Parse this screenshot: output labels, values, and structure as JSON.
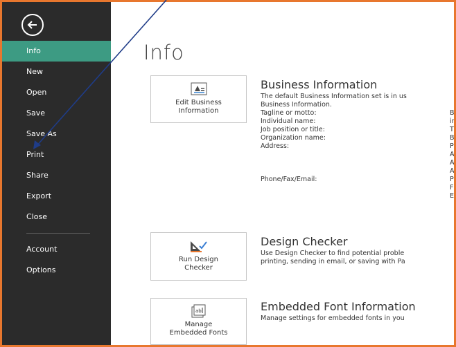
{
  "sidebar": {
    "items": [
      {
        "label": "Info",
        "active": true
      },
      {
        "label": "New"
      },
      {
        "label": "Open"
      },
      {
        "label": "Save"
      },
      {
        "label": "Save As"
      },
      {
        "label": "Print"
      },
      {
        "label": "Share"
      },
      {
        "label": "Export"
      },
      {
        "label": "Close"
      }
    ],
    "lower_items": [
      {
        "label": "Account"
      },
      {
        "label": "Options"
      }
    ]
  },
  "main": {
    "title": "Info",
    "business": {
      "button_line1": "Edit Business",
      "button_line2": "Information",
      "heading": "Business Information",
      "desc_line1": "The default Business Information set is in us",
      "desc_line2": "Business Information.",
      "fields": [
        {
          "label": "Tagline or motto:",
          "value": "B"
        },
        {
          "label": "Individual name:",
          "value": "in"
        },
        {
          "label": "Job position or title:",
          "value": "Ti"
        },
        {
          "label": "Organization name:",
          "value": "B"
        },
        {
          "label": "Address:",
          "value": "P"
        },
        {
          "label": "",
          "value": "A"
        },
        {
          "label": "",
          "value": "A"
        },
        {
          "label": "",
          "value": "A"
        },
        {
          "label": "Phone/Fax/Email:",
          "value": "P"
        },
        {
          "label": "",
          "value": "F"
        },
        {
          "label": "",
          "value": "E"
        }
      ]
    },
    "design": {
      "button_line1": "Run Design",
      "button_line2": "Checker",
      "heading": "Design Checker",
      "desc_line1": "Use Design Checker to find potential proble",
      "desc_line2": "printing, sending in email, or saving with Pa"
    },
    "fonts": {
      "button_line1": "Manage",
      "button_line2": "Embedded Fonts",
      "heading": "Embedded Font Information",
      "desc_line1": "Manage settings for embedded fonts in you"
    }
  },
  "colors": {
    "sidebar_bg": "#2b2b2b",
    "active_item": "#3d9b83",
    "frame_border": "#e8772e",
    "annotation_arrow": "#1f3c88"
  }
}
